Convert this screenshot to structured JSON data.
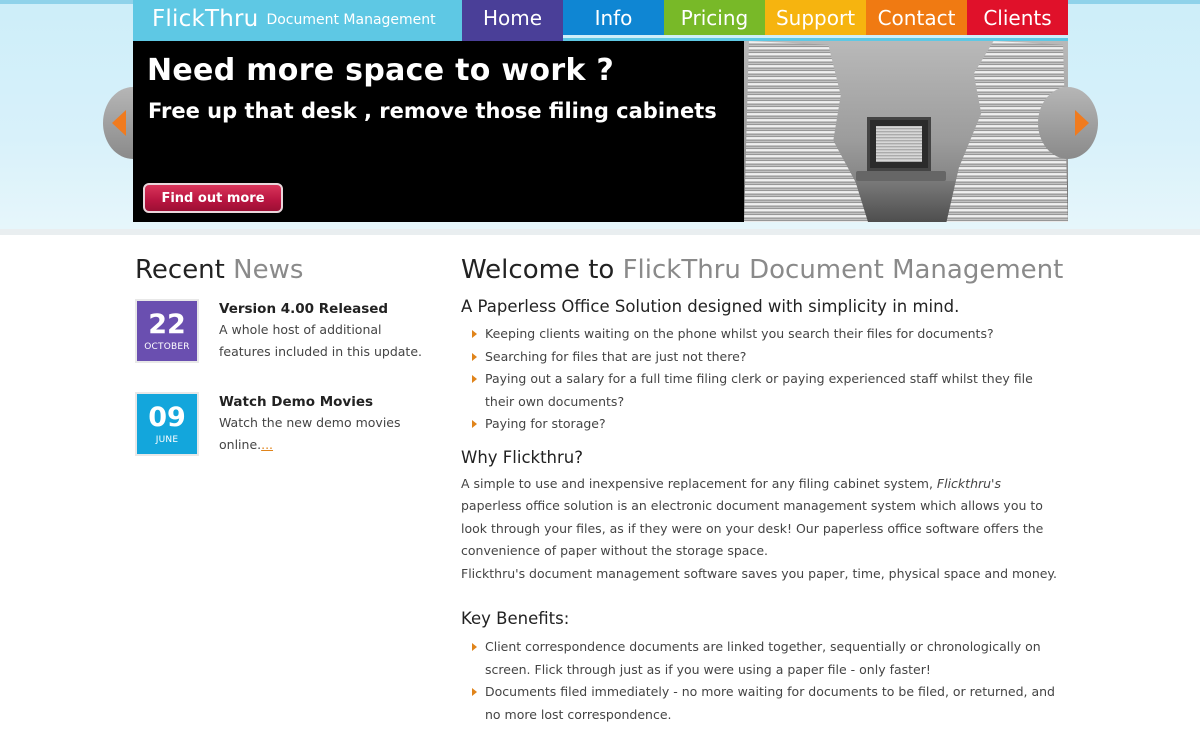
{
  "logo": {
    "main": "FlickThru",
    "sub": "Document Management"
  },
  "nav": [
    {
      "label": "Home",
      "color": "#4a3f98"
    },
    {
      "label": "Info",
      "color": "#0f86d3"
    },
    {
      "label": "Pricing",
      "color": "#78b928"
    },
    {
      "label": "Support",
      "color": "#f6b40f"
    },
    {
      "label": "Contact",
      "color": "#f07a12"
    },
    {
      "label": "Clients",
      "color": "#e0112a"
    }
  ],
  "slider": {
    "title": "Need more space to work ?",
    "subtitle": "Free up that desk , remove those filing cabinets",
    "button": "Find out more",
    "prev_icon": "chevron-left-icon",
    "next_icon": "chevron-right-icon"
  },
  "news": {
    "title_dark": "Recent",
    "title_light": "News",
    "items": [
      {
        "day": "22",
        "month": "OCTOBER",
        "color": "#6a4fb0",
        "title": "Version 4.00 Released",
        "body": "A whole host of additional features included in this update.",
        "more": ""
      },
      {
        "day": "09",
        "month": "JUNE",
        "color": "#13a6dc",
        "title": "Watch Demo Movies",
        "body": "Watch the new demo movies online.",
        "more": "..."
      }
    ]
  },
  "main": {
    "welcome_dark": "Welcome to",
    "welcome_light": "FlickThru Document Management",
    "subtitle": "A Paperless Office Solution designed with simplicity in mind.",
    "questions": [
      "Keeping clients waiting on the phone whilst you search their files for documents?",
      "Searching for files that are just not there?",
      "Paying out a salary for a full time filing clerk or paying experienced staff whilst they file their own documents?",
      "Paying for storage?"
    ],
    "why_title": "Why Flickthru?",
    "why_p1_a": "A simple to use and inexpensive replacement for any filing cabinet system,",
    "why_p1_em": "Flickthru's",
    "why_p1_b": "paperless office solution is an electronic document management system which allows you to look through your files, as if they were on your desk! Our paperless office software offers the convenience of paper without the storage space.",
    "why_p2": "Flickthru's document management software saves you paper, time, physical space and money.",
    "benefits_title": "Key Benefits:",
    "benefits": [
      "Client correspondence documents are linked together, sequentially or chronologically on screen. Flick through just as if you were using a paper file - only faster!",
      "Documents filed immediately - no more waiting for documents to be filed, or returned, and no more lost correspondence."
    ]
  }
}
